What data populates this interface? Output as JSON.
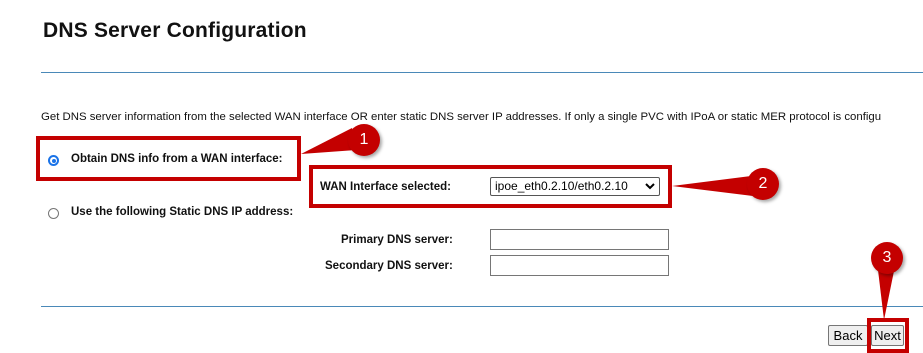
{
  "page": {
    "title": "DNS Server Configuration",
    "description": "Get DNS server information from the selected WAN interface OR enter static DNS server IP addresses. If only a single PVC with IPoA or static MER protocol is configu"
  },
  "options": {
    "wan_label": "Obtain DNS info from a WAN interface:",
    "wan_checked": true,
    "static_label": "Use the following Static DNS IP address:",
    "static_checked": false
  },
  "wan_interface": {
    "label": "WAN Interface selected:",
    "selected": "ipoe_eth0.2.10/eth0.2.10"
  },
  "static_dns": {
    "primary_label": "Primary DNS server:",
    "primary_value": "",
    "secondary_label": "Secondary DNS server:",
    "secondary_value": ""
  },
  "buttons": {
    "back": "Back",
    "next": "Next"
  },
  "annotations": {
    "badge1": "1",
    "badge2": "2",
    "badge3": "3",
    "color": "#c40000"
  },
  "colors": {
    "divider": "#4a89b8",
    "radio_accent": "#1a73e8"
  }
}
